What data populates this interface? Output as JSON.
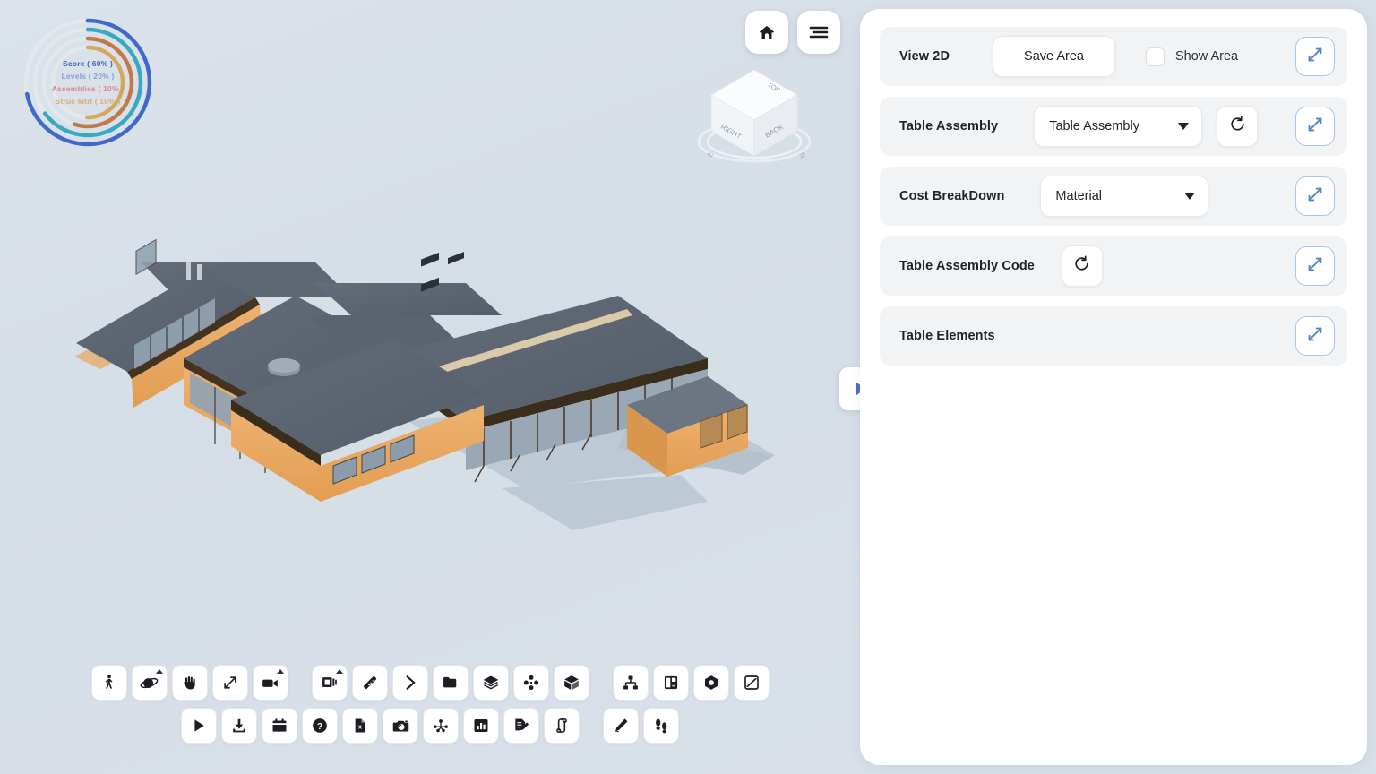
{
  "score_widget": {
    "metrics": [
      {
        "label": "Score ( 60% )",
        "value": 60,
        "color": "#3f63b5"
      },
      {
        "label": "Levels ( 20% )",
        "value": 20,
        "color": "#7fa3d6"
      },
      {
        "label": "Assemblies ( 10% )",
        "value": 10,
        "color": "#e0848c"
      },
      {
        "label": "Struc Mtrl ( 10% )",
        "value": 10,
        "color": "#d8b070"
      }
    ],
    "arc_colors": [
      "#4169c9",
      "#3aa8c0",
      "#c07a4a",
      "#d6a85c"
    ],
    "track_color": "#e3e8ed"
  },
  "top_nav": {
    "home_icon": "home-icon",
    "menu_icon": "hamburger-menu-icon"
  },
  "view_cube": {
    "faces": {
      "top": "TOP",
      "right": "RIGHT",
      "back": "BACK"
    },
    "compass": {
      "east": "E",
      "north": "N"
    }
  },
  "toolbar": {
    "row1": [
      {
        "name": "walk-tool",
        "icon": "person-walk-icon",
        "menu": false
      },
      {
        "name": "orbit-tool",
        "icon": "orbit-icon",
        "menu": true
      },
      {
        "name": "pan-tool",
        "icon": "hand-pan-icon",
        "menu": false
      },
      {
        "name": "zoom-tool",
        "icon": "zoom-diagonal-icon",
        "menu": false
      },
      {
        "name": "camera-tool",
        "icon": "video-camera-icon",
        "menu": true
      },
      {
        "name": "views-tool",
        "icon": "stacked-frames-icon",
        "menu": true
      },
      {
        "name": "measure-tool",
        "icon": "ruler-icon",
        "menu": false
      },
      {
        "name": "next-tool",
        "icon": "chevron-right-icon",
        "menu": false
      },
      {
        "name": "folder-tool",
        "icon": "folder-icon",
        "menu": false
      },
      {
        "name": "layers-tool",
        "icon": "layers-icon",
        "menu": false
      },
      {
        "name": "section-tool",
        "icon": "four-nodes-icon",
        "menu": false
      },
      {
        "name": "box-tool",
        "icon": "cube-icon",
        "menu": false
      },
      {
        "name": "hierarchy-tool",
        "icon": "tree-hierarchy-icon",
        "menu": false
      },
      {
        "name": "split-view-tool",
        "icon": "split-panel-icon",
        "menu": false
      },
      {
        "name": "properties-tool",
        "icon": "hexagon-icon",
        "menu": false
      },
      {
        "name": "transform-tool",
        "icon": "resize-arrows-icon",
        "menu": false
      }
    ],
    "row2": [
      {
        "name": "play-tool",
        "icon": "play-icon",
        "menu": false
      },
      {
        "name": "download-tool",
        "icon": "download-icon",
        "menu": false
      },
      {
        "name": "schedule-tool",
        "icon": "calendar-icon",
        "menu": false
      },
      {
        "name": "help-tool",
        "icon": "question-circle-icon",
        "menu": false
      },
      {
        "name": "excel-export-tool",
        "icon": "excel-file-icon",
        "menu": false
      },
      {
        "name": "snapshot-tool",
        "icon": "photo-camera-icon",
        "menu": false
      },
      {
        "name": "network-tool",
        "icon": "node-graph-icon",
        "menu": false
      },
      {
        "name": "chart-tool",
        "icon": "bar-chart-icon",
        "menu": false
      },
      {
        "name": "report-tool",
        "icon": "document-edit-icon",
        "menu": false
      },
      {
        "name": "compare-tool",
        "icon": "sync-compare-icon",
        "menu": false
      },
      {
        "name": "markup-tool",
        "icon": "pencil-icon",
        "menu": false
      },
      {
        "name": "footsteps-tool",
        "icon": "footsteps-icon",
        "menu": false
      }
    ]
  },
  "panel": {
    "rows": [
      {
        "label": "View 2D",
        "save_label": "Save Area",
        "checkbox_label": "Show Area",
        "checkbox_checked": false
      },
      {
        "label": "Table Assembly",
        "select_value": "Table Assembly",
        "has_refresh": true
      },
      {
        "label": "Cost BreakDown",
        "select_value": "Material",
        "has_refresh": false
      },
      {
        "label": "Table Assembly Code",
        "has_refresh": true
      },
      {
        "label": "Table Elements"
      }
    ],
    "expand_icon": "expand-diagonal-icon",
    "refresh_icon": "refresh-icon",
    "collapse_tab_icon": "chevron-right-triangle-icon"
  },
  "colors": {
    "canvas_bg": "#d8e0e8",
    "panel_bg": "#ffffff",
    "row_bg": "#f1f3f5",
    "accent_blue": "#4a6fc4",
    "expand_border": "#a9c8e8",
    "roof": "#5b6470",
    "wall": "#e8a860",
    "glass": "#9aa8b6",
    "terrain": "#b9c6d1"
  }
}
